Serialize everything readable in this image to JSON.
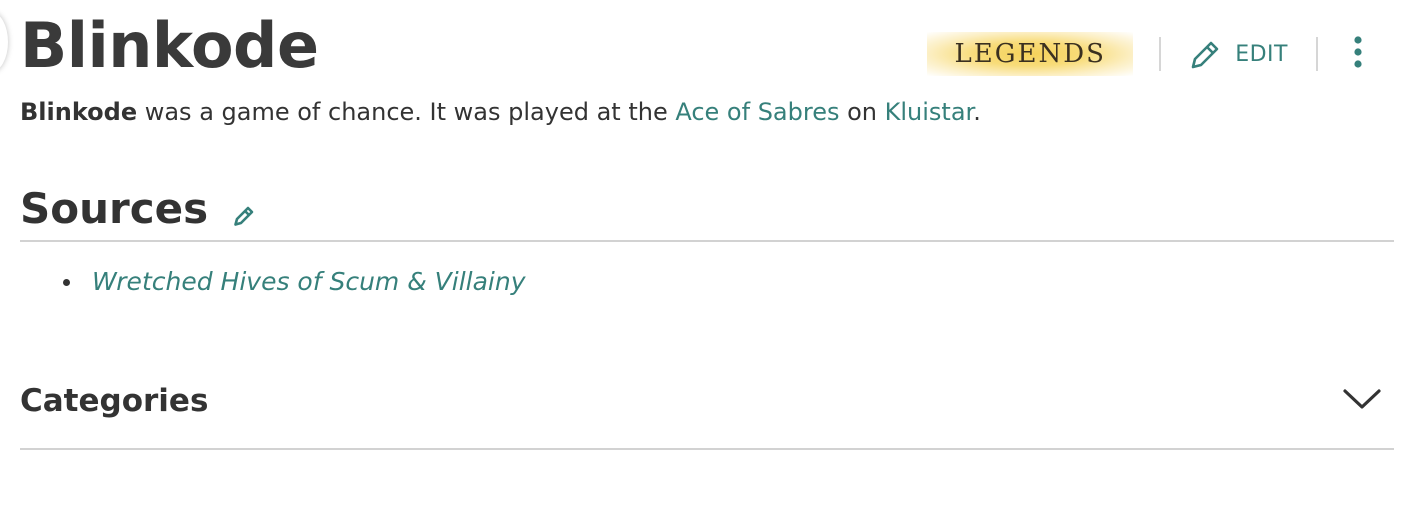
{
  "page": {
    "title": "Blinkode",
    "badge": "LEGENDS",
    "edit_label": "EDIT"
  },
  "intro": {
    "term": "Blinkode",
    "text_1": " was a game of chance. It was played at the ",
    "link_1": "Ace of Sabres",
    "text_2": " on ",
    "link_2": "Kluistar",
    "text_3": "."
  },
  "sources": {
    "heading": "Sources",
    "items": [
      {
        "label": "Wretched Hives of Scum & Villainy"
      }
    ]
  },
  "categories": {
    "label": "Categories"
  },
  "icons": {
    "edit": "pencil-icon",
    "more": "more-vertical-icon",
    "section_edit": "pencil-icon",
    "expand": "chevron-down-icon"
  },
  "colors": {
    "link": "#36807b",
    "text": "#333333",
    "badge_gold": "#f5d25a",
    "divider": "#d2d2d2"
  }
}
